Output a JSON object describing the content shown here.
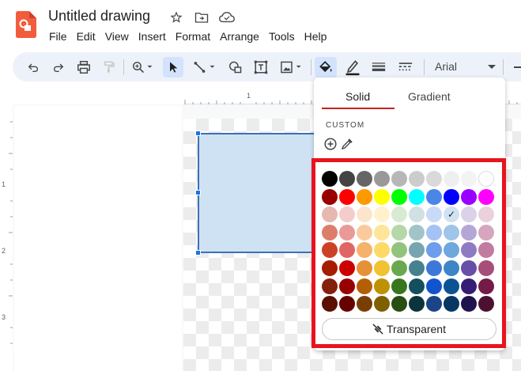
{
  "document": {
    "title": "Untitled drawing"
  },
  "menu": [
    "File",
    "Edit",
    "View",
    "Insert",
    "Format",
    "Arrange",
    "Tools",
    "Help"
  ],
  "toolbar": {
    "font": "Arial"
  },
  "ruler": {
    "top": [
      "1"
    ],
    "left": [
      "1",
      "2",
      "3"
    ]
  },
  "fill_popup": {
    "tabs": {
      "solid": "Solid",
      "gradient": "Gradient"
    },
    "custom_label": "CUSTOM",
    "transparent_label": "Transparent",
    "selected_swatch": 27,
    "palette": [
      "#000000",
      "#434343",
      "#666666",
      "#999999",
      "#b7b7b7",
      "#cccccc",
      "#d9d9d9",
      "#efefef",
      "#f3f3f3",
      "#ffffff",
      "#980000",
      "#ff0000",
      "#ff9900",
      "#ffff00",
      "#00ff00",
      "#00ffff",
      "#4a86e8",
      "#0000ff",
      "#9900ff",
      "#ff00ff",
      "#e6b8af",
      "#f4cccc",
      "#fce5cd",
      "#fff2cc",
      "#d9ead3",
      "#d0e0e3",
      "#c9daf8",
      "#cfe2f3",
      "#d9d2e9",
      "#ead1dc",
      "#dd7e6b",
      "#ea9999",
      "#f9cb9c",
      "#ffe599",
      "#b6d7a8",
      "#a2c4c9",
      "#a4c2f4",
      "#9fc5e8",
      "#b4a7d6",
      "#d5a6bd",
      "#cc4125",
      "#e06666",
      "#f6b26b",
      "#ffd966",
      "#93c47d",
      "#76a5af",
      "#6d9eeb",
      "#6fa8dc",
      "#8e7cc3",
      "#c27ba0",
      "#a61c00",
      "#cc0000",
      "#e69138",
      "#f1c232",
      "#6aa84f",
      "#45818e",
      "#3c78d8",
      "#3d85c6",
      "#674ea7",
      "#a64d79",
      "#85200c",
      "#990000",
      "#b45f06",
      "#bf9000",
      "#38761d",
      "#134f5c",
      "#1155cc",
      "#0b5394",
      "#351c75",
      "#741b47",
      "#5b0f00",
      "#660000",
      "#783f04",
      "#7f6000",
      "#274e13",
      "#0c343d",
      "#1c4587",
      "#073763",
      "#20124d",
      "#4c1130"
    ]
  },
  "colors": {
    "accent": "#c5221f",
    "highlight": "#e8141e",
    "shape_fill": "#cfe2f3",
    "shape_border": "#3d6fb5"
  }
}
